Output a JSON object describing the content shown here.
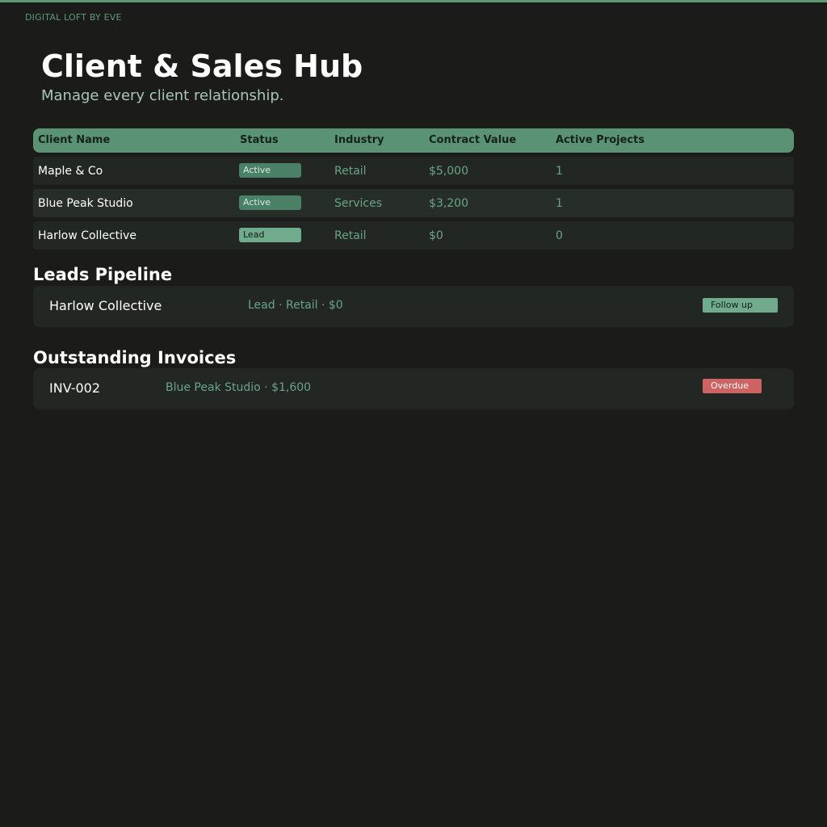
{
  "brand": "DIGITAL LOFT BY EVE",
  "header": {
    "title": "Client & Sales Hub",
    "subtitle": "Manage every client relationship."
  },
  "clients_table": {
    "columns": [
      "Client Name",
      "Status",
      "Industry",
      "Contract Value",
      "Active Projects"
    ],
    "rows": [
      {
        "name": "Maple & Co",
        "status": "Active",
        "industry": "Retail",
        "value": "$5,000",
        "projects": "1"
      },
      {
        "name": "Blue Peak Studio",
        "status": "Active",
        "industry": "Services",
        "value": "$3,200",
        "projects": "1"
      },
      {
        "name": "Harlow Collective",
        "status": "Lead",
        "industry": "Retail",
        "value": "$0",
        "projects": "0"
      }
    ]
  },
  "leads": {
    "title": "Leads Pipeline",
    "items": [
      {
        "name": "Harlow Collective",
        "meta": "Lead · Retail · $0",
        "action": "Follow up"
      }
    ]
  },
  "invoices": {
    "title": "Outstanding Invoices",
    "items": [
      {
        "id": "INV-002",
        "meta": "Blue Peak Studio · $1,600",
        "status": "Overdue"
      }
    ]
  },
  "colors": {
    "accent": "#5a9373",
    "background": "#1b1c1a",
    "overdue": "#cf6262"
  }
}
